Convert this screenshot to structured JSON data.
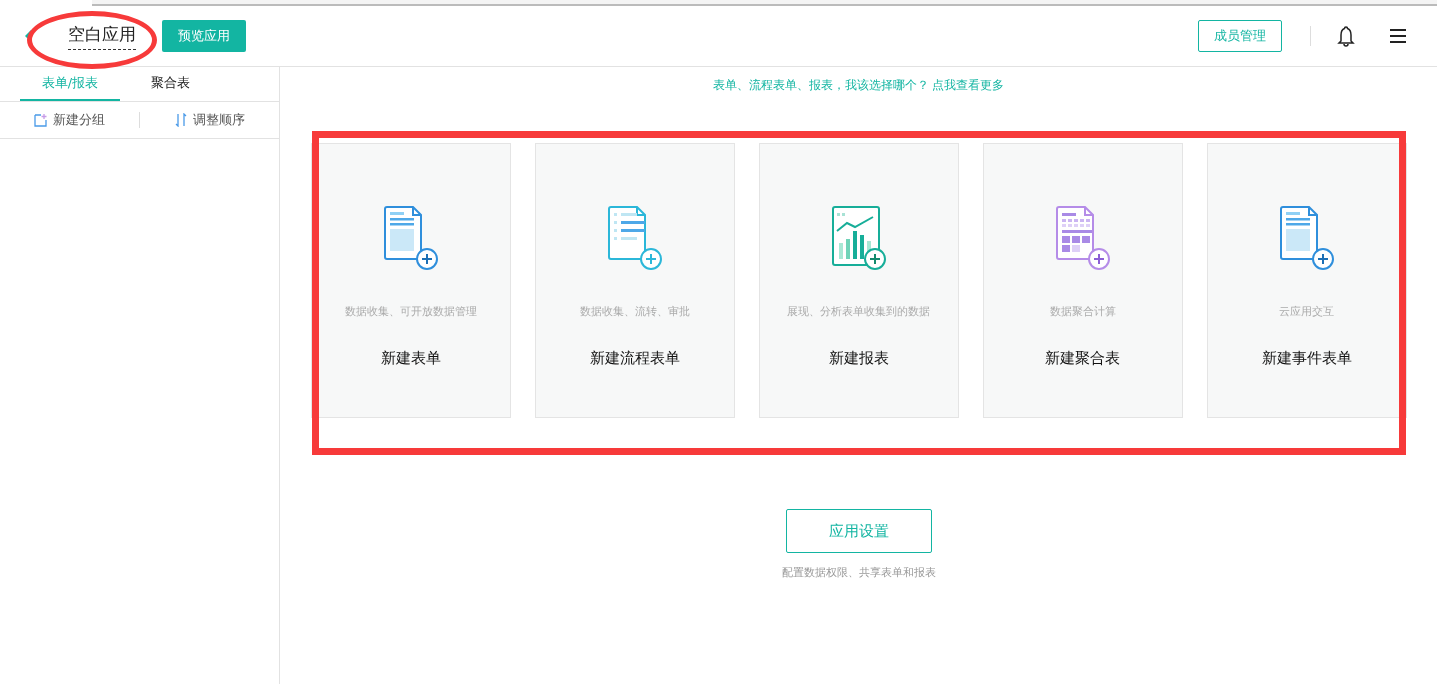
{
  "header": {
    "app_title": "空白应用",
    "preview_button": "预览应用",
    "members_button": "成员管理"
  },
  "sidebar": {
    "tabs": [
      {
        "label": "表单/报表",
        "selected": true
      },
      {
        "label": "聚合表",
        "selected": false
      }
    ],
    "actions": [
      {
        "kind": "new-group",
        "label": "新建分组"
      },
      {
        "kind": "reorder",
        "label": "调整顺序"
      }
    ]
  },
  "help": {
    "text": "表单、流程表单、报表，我该选择哪个？",
    "link": "点我查看更多"
  },
  "cards": [
    {
      "kind": "form",
      "description": "数据收集、可开放数据管理",
      "title": "新建表单"
    },
    {
      "kind": "process",
      "description": "数据收集、流转、审批",
      "title": "新建流程表单"
    },
    {
      "kind": "report",
      "description": "展现、分析表单收集到的数据",
      "title": "新建报表"
    },
    {
      "kind": "aggregate",
      "description": "数据聚合计算",
      "title": "新建聚合表"
    },
    {
      "kind": "event",
      "description": "云应用交互",
      "title": "新建事件表单"
    }
  ],
  "settings": {
    "button": "应用设置",
    "caption": "配置数据权限、共享表单和报表"
  }
}
